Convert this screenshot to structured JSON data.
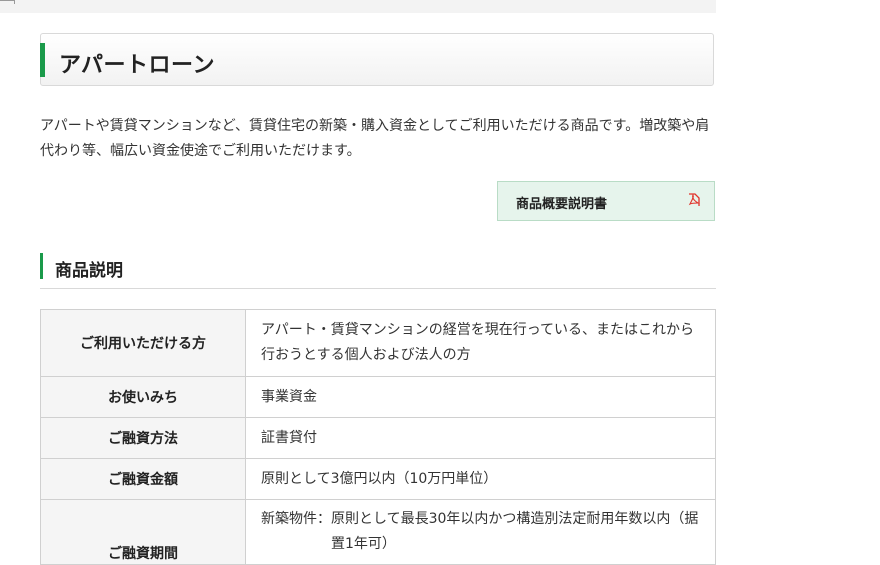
{
  "page": {
    "title": "アパートローン",
    "intro": "アパートや賃貸マンションなど、賃貸住宅の新築・購入資金としてご利用いただける商品です。増改築や肩代わり等、幅広い資金使途でご利用いただけます。"
  },
  "pdf_link": {
    "label": "商品概要説明書",
    "icon": "pdf-icon",
    "icon_color": "#e2332b"
  },
  "section": {
    "title": "商品説明"
  },
  "spec_table": {
    "rows": [
      {
        "label": "ご利用いただける方",
        "value": "アパート・賃貸マンションの経営を現在行っている、またはこれから行おうとする個人および法人の方"
      },
      {
        "label": "お使いみち",
        "value": "事業資金"
      },
      {
        "label": "ご融資方法",
        "value": "証書貸付"
      },
      {
        "label": "ご融資金額",
        "value": "原則として3億円以内（10万円単位）"
      },
      {
        "label": "ご融資期間",
        "value_line1": "新築物件：原則として最長30年以内かつ構造別法定耐用年数以内（据",
        "value_line2": "置1年可）"
      }
    ]
  },
  "colors": {
    "accent": "#1a9a4a",
    "pdf_button_bg": "#e6f4ec",
    "table_header_bg": "#f5f5f5"
  }
}
